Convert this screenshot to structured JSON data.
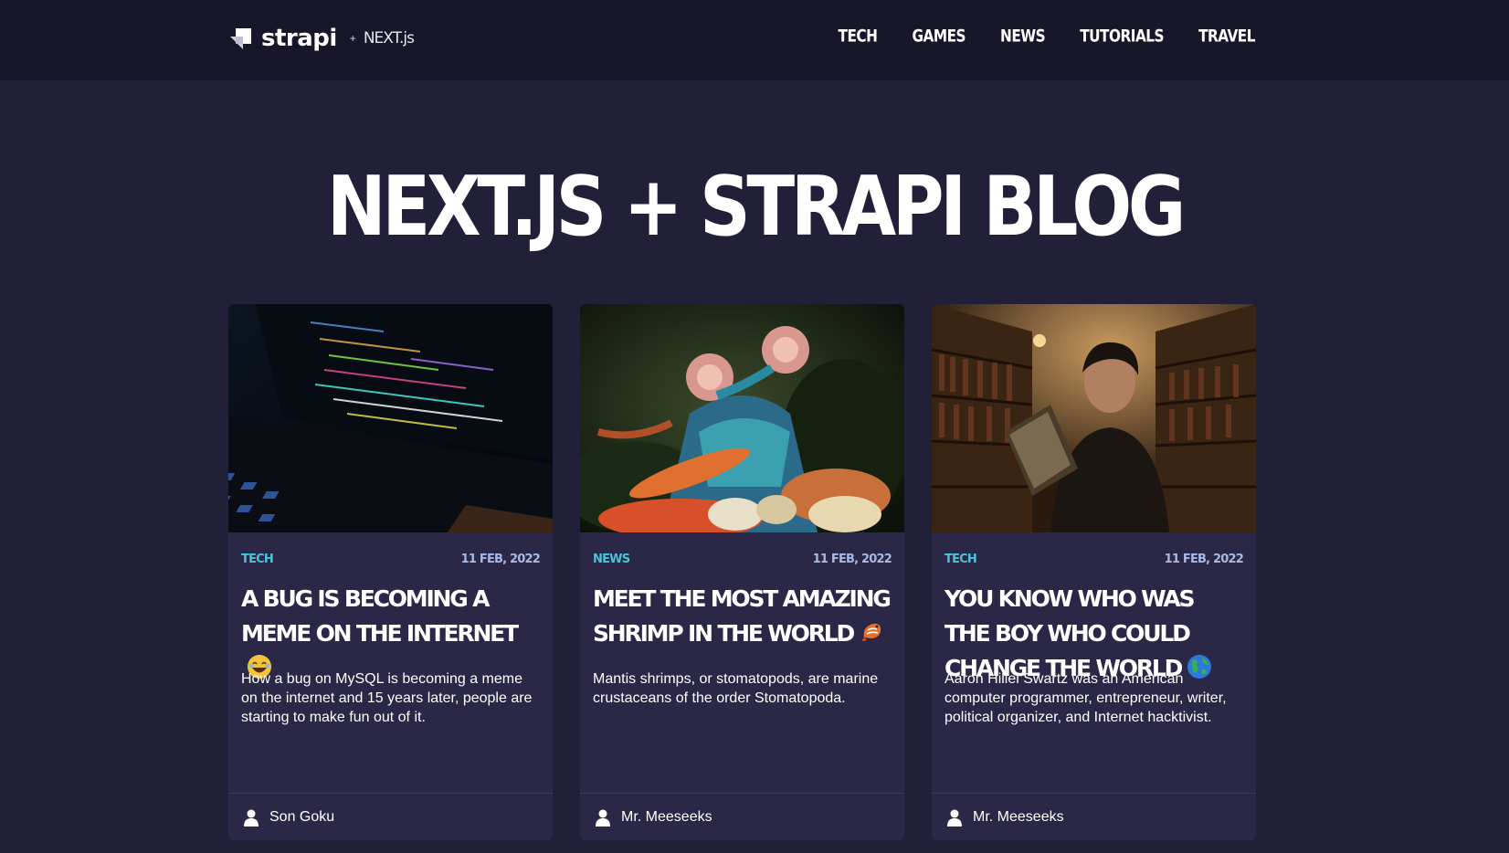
{
  "header": {
    "logo_text": "strapi",
    "logo_plus": "+",
    "logo_partner": "NEXT.js",
    "nav": [
      {
        "label": "TECH"
      },
      {
        "label": "GAMES"
      },
      {
        "label": "NEWS"
      },
      {
        "label": "TUTORIALS"
      },
      {
        "label": "TRAVEL"
      }
    ]
  },
  "hero": {
    "title": "NEXT.JS + STRAPI BLOG"
  },
  "articles": [
    {
      "category": "TECH",
      "date": "11 FEB, 2022",
      "title": "A BUG IS BECOMING A MEME ON THE INTERNET",
      "emoji": "laughing-emoji",
      "description": "How a bug on MySQL is becoming a meme on the internet and 15 years later, people are starting to make fun out of it.",
      "author": "Son Goku",
      "image": "laptop-code-photo"
    },
    {
      "category": "NEWS",
      "date": "11 FEB, 2022",
      "title": "MEET THE MOST AMAZING SHRIMP IN THE WORLD",
      "emoji": "shrimp-emoji",
      "description": "Mantis shrimps, or stomatopods, are marine crustaceans of the order Stomatopoda.",
      "author": "Mr. Meeseeks",
      "image": "mantis-shrimp-photo"
    },
    {
      "category": "TECH",
      "date": "11 FEB, 2022",
      "title": "YOU KNOW WHO WAS THE BOY WHO COULD CHANGE THE WORLD",
      "emoji": "globe-emoji",
      "description": "Aaron Hillel Swartz was an American computer programmer, entrepreneur, writer, political organizer, and Internet hacktivist.",
      "author": "Mr. Meeseeks",
      "image": "library-portrait-photo"
    }
  ],
  "colors": {
    "header_bg": "#17162a",
    "page_bg": "#222039",
    "card_bg": "#2a2846",
    "category_accent": "#4bc3d8",
    "date_color": "#a9b8e8"
  }
}
